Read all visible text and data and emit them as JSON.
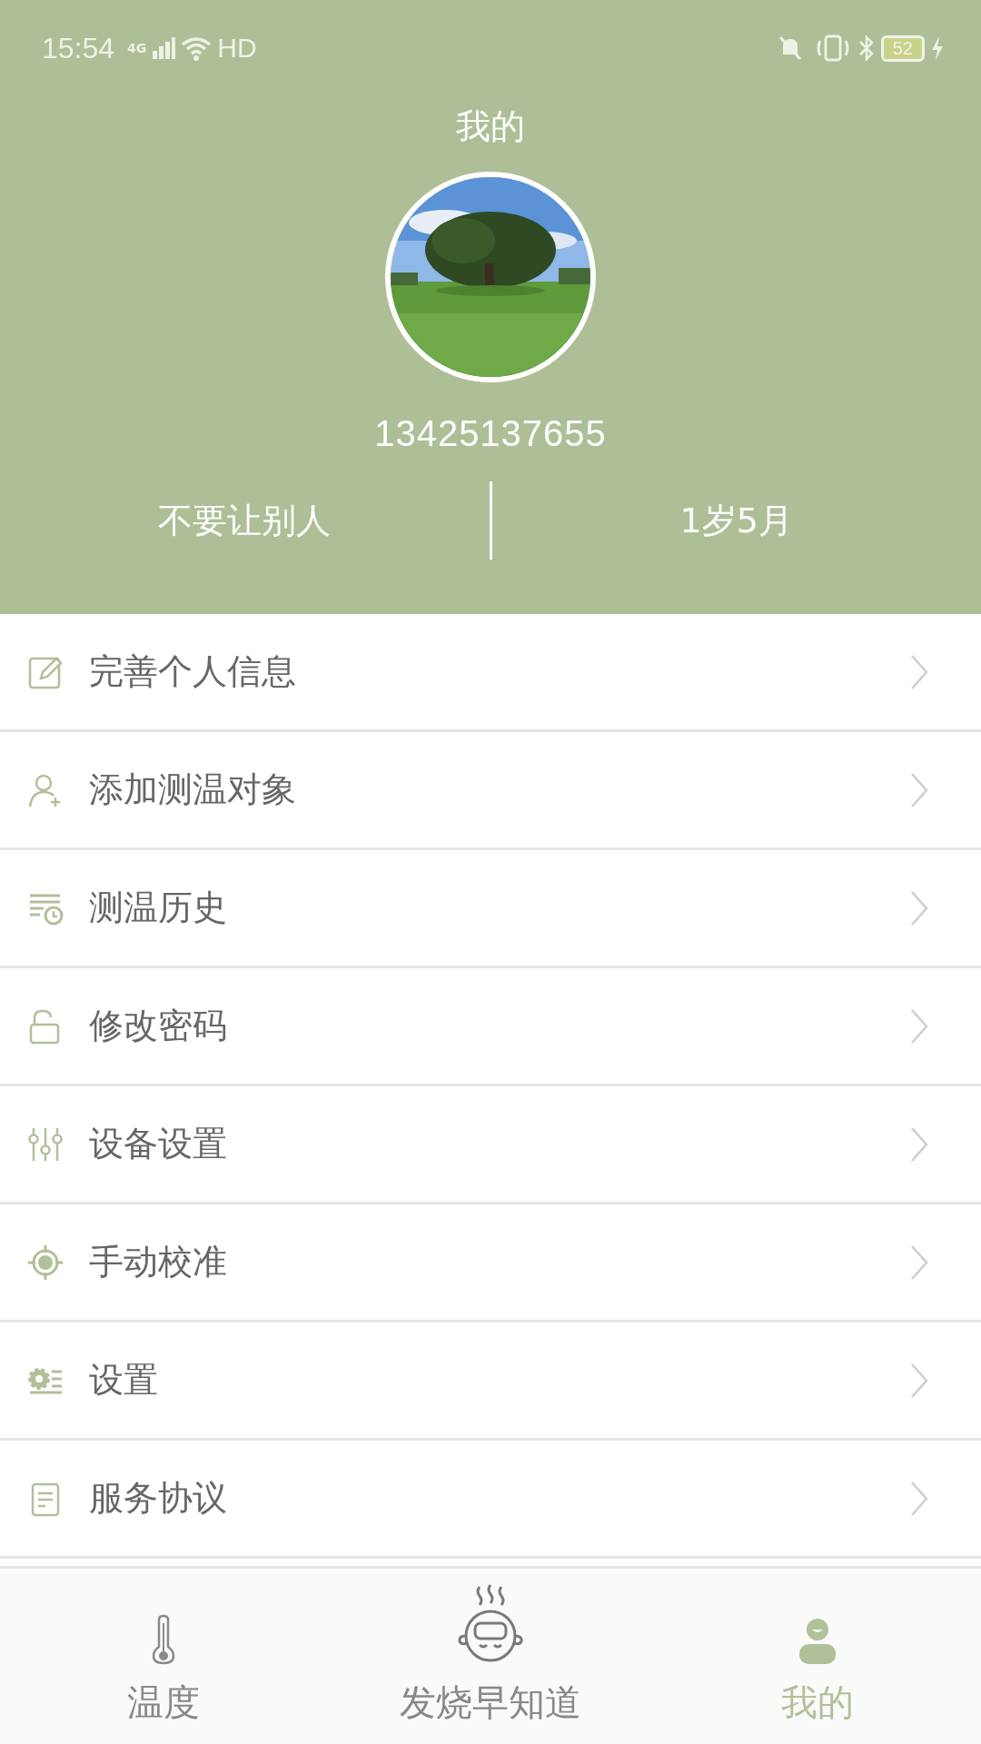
{
  "status_bar": {
    "time": "15:54",
    "network": "4G",
    "wifi_label": "HD",
    "battery": "52"
  },
  "header": {
    "title": "我的",
    "phone": "13425137655",
    "name": "不要让别人",
    "age": "1岁5月"
  },
  "menu": [
    {
      "kind": "edit",
      "label": "完善个人信息"
    },
    {
      "kind": "add-user",
      "label": "添加测温对象"
    },
    {
      "kind": "history",
      "label": "测温历史"
    },
    {
      "kind": "lock",
      "label": "修改密码"
    },
    {
      "kind": "sliders",
      "label": "设备设置"
    },
    {
      "kind": "target",
      "label": "手动校准"
    },
    {
      "kind": "gear",
      "label": "设置"
    },
    {
      "kind": "document",
      "label": "服务协议"
    }
  ],
  "tabs": [
    {
      "kind": "thermometer",
      "label": "温度",
      "selected": false
    },
    {
      "kind": "baby",
      "label": "发烧早知道",
      "selected": false
    },
    {
      "kind": "person",
      "label": "我的",
      "selected": true
    }
  ]
}
